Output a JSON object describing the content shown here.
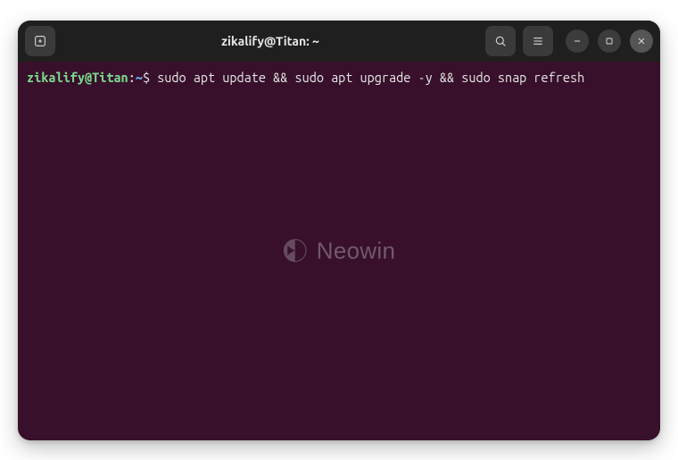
{
  "window": {
    "title": "zikalify@Titan: ~"
  },
  "terminal": {
    "prompt": {
      "user_host": "zikalify@Titan",
      "separator": ":",
      "path": "~",
      "symbol": "$"
    },
    "command": "sudo apt update && sudo apt upgrade -y && sudo snap refresh"
  },
  "watermark": {
    "text": "Neowin"
  },
  "colors": {
    "titlebar_bg": "#1f1f1f",
    "terminal_bg": "#38102b",
    "prompt_user": "#7bd88f",
    "prompt_path": "#6aa8e8",
    "text": "#e6e6e6"
  }
}
